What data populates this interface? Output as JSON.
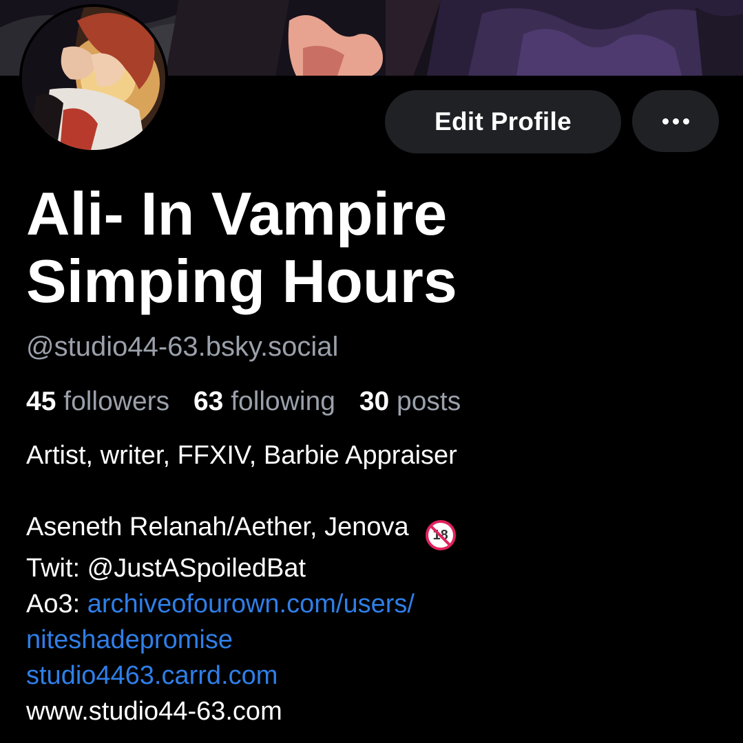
{
  "profile": {
    "display_name_line1": "Ali- In Vampire",
    "display_name_line2": "Simping Hours",
    "handle": "@studio44-63.bsky.social",
    "edit_label": "Edit Profile",
    "more_icon": "ellipsis-icon",
    "age_badge": "18",
    "age_badge_icon": "no-under-18-icon"
  },
  "stats": {
    "followers_count": "45",
    "followers_label": "followers",
    "following_count": "63",
    "following_label": "following",
    "posts_count": "30",
    "posts_label": "posts"
  },
  "bio": {
    "line1": "Artist, writer, FFXIV, Barbie Appraiser",
    "line2": "Aseneth Relanah/Aether, Jenova",
    "line3": "Twit: @JustASpoiledBat",
    "line4_prefix": "Ao3: ",
    "line4_link": "archiveofourown.com/users/",
    "line5_link": "niteshadepromise",
    "line6_link": "studio4463.carrd.com",
    "line7": "www.studio44-63.com"
  },
  "colors": {
    "background": "#000000",
    "button": "#1f2125",
    "muted_text": "#9ba1ab",
    "link": "#2f7fe8",
    "badge_red": "#e0245e"
  }
}
